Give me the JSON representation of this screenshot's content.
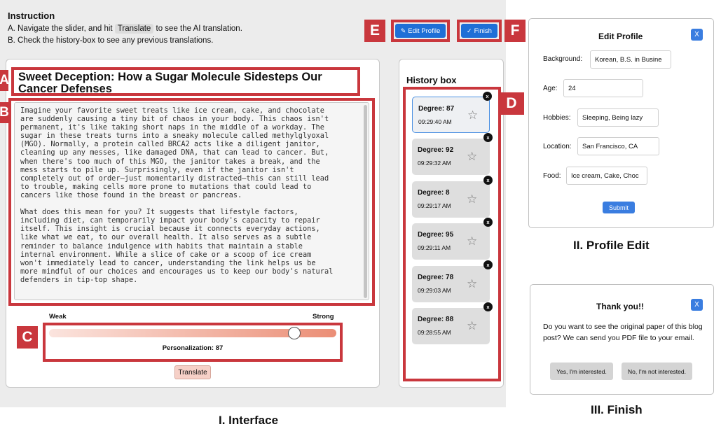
{
  "instruction": {
    "title": "Instruction",
    "line_a_prefix": "A. Navigate the slider, and hit",
    "line_a_chip": "Translate",
    "line_a_suffix": "to see the AI translation.",
    "line_b": "B. Check the history-box to see any previous translations."
  },
  "labels": {
    "a": "A",
    "b": "B",
    "c": "C",
    "d": "D",
    "e": "E",
    "f": "F"
  },
  "header_buttons": {
    "edit_profile": "Edit Profile",
    "finish": "Finish"
  },
  "article": {
    "title": "Sweet Deception: How a Sugar Molecule Sidesteps Our Cancer Defenses",
    "body": "Imagine your favorite sweet treats like ice cream, cake, and chocolate\nare suddenly causing a tiny bit of chaos in your body. This chaos isn't\npermanent, it's like taking short naps in the middle of a workday. The\nsugar in these treats turns into a sneaky molecule called methylglyoxal\n(MGO). Normally, a protein called BRCA2 acts like a diligent janitor,\ncleaning up any messes, like damaged DNA, that can lead to cancer. But,\nwhen there's too much of this MGO, the janitor takes a break, and the\nmess starts to pile up. Surprisingly, even if the janitor isn't\ncompletely out of order—just momentarily distracted—this can still lead\nto trouble, making cells more prone to mutations that could lead to\ncancers like those found in the breast or pancreas.\n\nWhat does this mean for you? It suggests that lifestyle factors,\nincluding diet, can temporarily impact your body's capacity to repair\nitself. This insight is crucial because it connects everyday actions,\nlike what we eat, to our overall health. It also serves as a subtle\nreminder to balance indulgence with habits that maintain a stable\ninternal environment. While a slice of cake or a scoop of ice cream\nwon't immediately lead to cancer, understanding the link helps us be\nmore mindful of our choices and encourages us to keep our body's natural\ndefenders in tip-top shape."
  },
  "slider": {
    "weak_label": "Weak",
    "strong_label": "Strong",
    "personalization_text": "Personalization: 87",
    "value": 87,
    "min": 0,
    "max": 100
  },
  "translate_button": "Translate",
  "history": {
    "title": "History box",
    "close_glyph": "x",
    "items": [
      {
        "degree": "Degree: 87",
        "time": "09:29:40 AM",
        "selected": true
      },
      {
        "degree": "Degree: 92",
        "time": "09:29:32 AM",
        "selected": false
      },
      {
        "degree": "Degree: 8",
        "time": "09:29:17 AM",
        "selected": false
      },
      {
        "degree": "Degree: 95",
        "time": "09:29:11 AM",
        "selected": false
      },
      {
        "degree": "Degree: 78",
        "time": "09:29:03 AM",
        "selected": false
      },
      {
        "degree": "Degree: 88",
        "time": "09:28:55 AM",
        "selected": false
      }
    ]
  },
  "profile_edit": {
    "title": "Edit Profile",
    "close_label": "X",
    "fields": [
      {
        "label": "Background:",
        "value": "Korean, B.S. in Busine"
      },
      {
        "label": "Age:",
        "value": "24"
      },
      {
        "label": "Hobbies:",
        "value": "Sleeping, Being lazy"
      },
      {
        "label": "Location:",
        "value": "San Francisco, CA"
      },
      {
        "label": "Food:",
        "value": "Ice cream, Cake, Choc"
      }
    ],
    "submit": "Submit"
  },
  "finish_dialog": {
    "title": "Thank you!!",
    "close_label": "X",
    "body": "Do you want to see the original paper of this blog post? We can send you PDF file to your email.",
    "yes": "Yes, I'm interested.",
    "no": "No, I'm not interested."
  },
  "captions": {
    "interface": "I. Interface",
    "profile": "II. Profile Edit",
    "finish": "III. Finish"
  },
  "colors": {
    "highlight_red": "#c9373d",
    "primary_blue": "#1f6fd6",
    "translate_peach": "#f6d0c7",
    "slider_end": "#eb8e76"
  }
}
